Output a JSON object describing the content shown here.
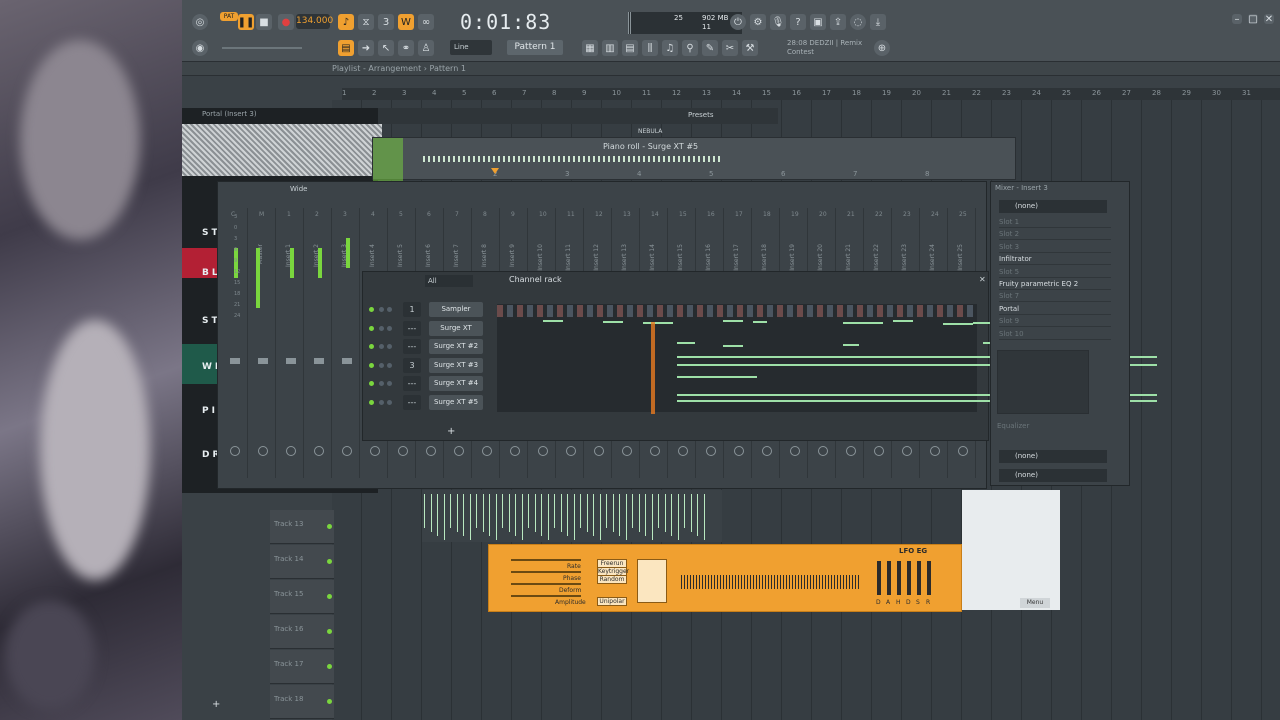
{
  "transport": {
    "tempo": "134.000",
    "clock": "0:01:83",
    "pat_label": "PAT",
    "clock_sub": "M:S:CS"
  },
  "cpu": {
    "cpu_value": "25",
    "mem_value": "902 MB",
    "poly": "11"
  },
  "hint": {
    "line1": "28:08  DEDZII | Remix",
    "line2": "Contest"
  },
  "toolbar": {
    "snap": "Line",
    "pattern": "Pattern 1"
  },
  "playlist": {
    "breadcrumb": "Playlist - Arrangement › Pattern 1",
    "ruler": [
      "1",
      "2",
      "3",
      "4",
      "5",
      "6",
      "7",
      "8",
      "9",
      "10",
      "11",
      "12",
      "13",
      "14",
      "15",
      "16",
      "17",
      "18",
      "19",
      "20",
      "21",
      "22",
      "23",
      "24",
      "25",
      "26",
      "27",
      "28",
      "29",
      "30",
      "31"
    ],
    "tracks": [
      "Track 13",
      "Track 14",
      "Track 15",
      "Track 16",
      "Track 17",
      "Track 18"
    ]
  },
  "portal": {
    "title": "Portal (Insert 3)",
    "presets": "Presets",
    "nebula": "NEBULA",
    "sections": [
      "ST",
      "BL",
      "ST",
      "WH",
      "PIT",
      "DR"
    ]
  },
  "pianoroll": {
    "title": "Piano roll - Surge XT #5",
    "ruler": [
      "2",
      "3",
      "4",
      "5",
      "6",
      "7",
      "8"
    ]
  },
  "mixer": {
    "preset": "Wide",
    "master": "Master",
    "strip_numbers": [
      "C",
      "M",
      "1",
      "2",
      "3",
      "4",
      "5",
      "6",
      "7",
      "8",
      "9",
      "10",
      "11",
      "12",
      "13",
      "14",
      "15",
      "16",
      "17",
      "18",
      "19",
      "20",
      "21",
      "22",
      "23",
      "24",
      "25"
    ],
    "inserts": [
      "Insert 1",
      "Insert 2",
      "Insert 3",
      "Insert 4",
      "Insert 5",
      "Insert 6",
      "Insert 7",
      "Insert 8",
      "Insert 9",
      "Insert 10",
      "Insert 11",
      "Insert 12",
      "Insert 13",
      "Insert 14",
      "Insert 15",
      "Insert 16",
      "Insert 17",
      "Insert 18",
      "Insert 19",
      "Insert 20",
      "Insert 21",
      "Insert 22",
      "Insert 23",
      "Insert 24",
      "Insert 25"
    ],
    "db_scale": [
      "3",
      "0",
      "3",
      "6",
      "9",
      "12",
      "15",
      "18",
      "21",
      "24"
    ]
  },
  "channelrack": {
    "title": "Channel rack",
    "filter": "All",
    "add": "+",
    "channels": [
      {
        "num": "1",
        "name": "Sampler"
      },
      {
        "num": "---",
        "name": "Surge XT"
      },
      {
        "num": "---",
        "name": "Surge XT #2"
      },
      {
        "num": "3",
        "name": "Surge XT #3"
      },
      {
        "num": "---",
        "name": "Surge XT #4"
      },
      {
        "num": "---",
        "name": "Surge XT #5"
      }
    ]
  },
  "insert_panel": {
    "title": "Mixer - Insert 3",
    "input": "(none)",
    "slots": [
      "Slot 1",
      "Slot 2",
      "Slot 3",
      "Infiltrator",
      "Slot 5",
      "Fruity parametric EQ 2",
      "Slot 7",
      "Portal",
      "Slot 9",
      "Slot 10"
    ],
    "equalizer": "Equalizer",
    "out1": "(none)",
    "out2": "(none)"
  },
  "lfo": {
    "title": "LFO EG",
    "labels": [
      "Rate",
      "Phase",
      "Deform",
      "Amplitude"
    ],
    "modes": [
      "Freerun",
      "Keytrigger",
      "Random"
    ],
    "unipolar": "Unipolar",
    "menu": "Menu",
    "adsr": [
      "D",
      "A",
      "H",
      "D",
      "S",
      "R"
    ]
  }
}
